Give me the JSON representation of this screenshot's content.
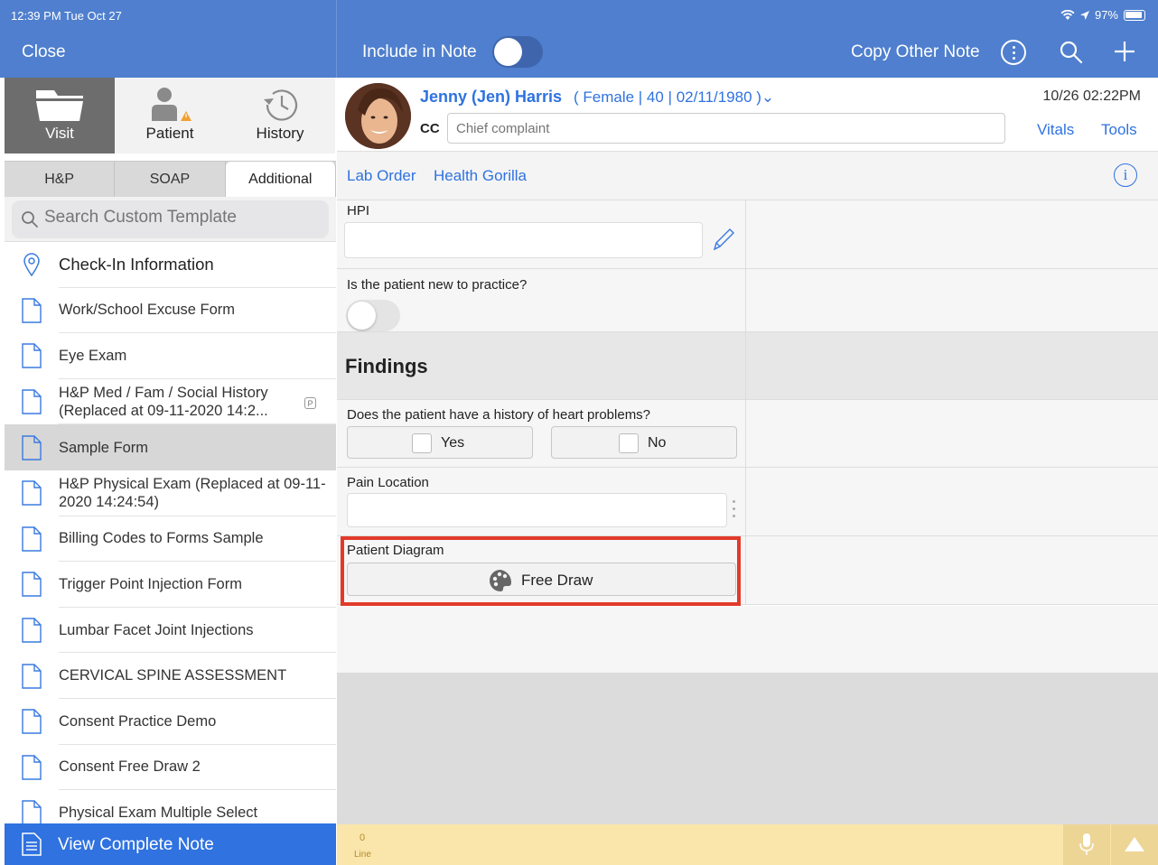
{
  "status": {
    "time": "12:39 PM  Tue Oct 27",
    "battery": "97%"
  },
  "topbar": {
    "close": "Close",
    "include_in_note": "Include in Note",
    "copy_other_note": "Copy Other Note"
  },
  "left": {
    "nav": [
      {
        "label": "Visit",
        "icon": "folder-icon"
      },
      {
        "label": "Patient",
        "icon": "person-warning-icon"
      },
      {
        "label": "History",
        "icon": "history-clock-icon"
      }
    ],
    "subtabs": [
      "H&P",
      "SOAP",
      "Additional"
    ],
    "search_placeholder": "Search Custom Template",
    "items": [
      {
        "label": "Check-In Information"
      },
      {
        "label": "Work/School Excuse Form"
      },
      {
        "label": "Eye Exam"
      },
      {
        "label": "H&P Med / Fam / Social History (Replaced at 09-11-2020 14:2...",
        "badge": "P"
      },
      {
        "label": "Sample Form"
      },
      {
        "label": "H&P Physical Exam (Replaced at 09-11-2020 14:24:54)"
      },
      {
        "label": "Billing Codes to Forms Sample"
      },
      {
        "label": "Trigger Point Injection Form"
      },
      {
        "label": "Lumbar Facet Joint Injections"
      },
      {
        "label": "CERVICAL SPINE ASSESSMENT"
      },
      {
        "label": "Consent Practice Demo"
      },
      {
        "label": "Consent Free Draw 2"
      },
      {
        "label": "Physical Exam Multiple Select"
      }
    ],
    "view_complete_note": "View Complete Note"
  },
  "patient": {
    "name": "Jenny (Jen) Harris",
    "info": "( Female | 40 | 02/11/1980 )⌄",
    "date": "10/26 02:22PM",
    "cc_label": "CC",
    "cc_placeholder": "Chief complaint",
    "vitals": "Vitals",
    "tools": "Tools"
  },
  "links": {
    "lab_order": "Lab Order",
    "health_gorilla": "Health Gorilla",
    "info": "i"
  },
  "form": {
    "hpi_label": "HPI",
    "new_patient_q": "Is the patient new to practice?",
    "findings": "Findings",
    "heart_q": "Does the patient have a history of heart problems?",
    "yes": "Yes",
    "no": "No",
    "pain_label": "Pain Location",
    "diagram_label": "Patient Diagram",
    "free_draw": "Free Draw"
  },
  "bottom": {
    "line_count": "0",
    "line_label": "Line"
  },
  "colors": {
    "header_blue": "#4f7fce",
    "link_blue": "#2f72e0",
    "highlight_red": "#e23a2a",
    "bottom_yellow": "#fae6aa"
  }
}
